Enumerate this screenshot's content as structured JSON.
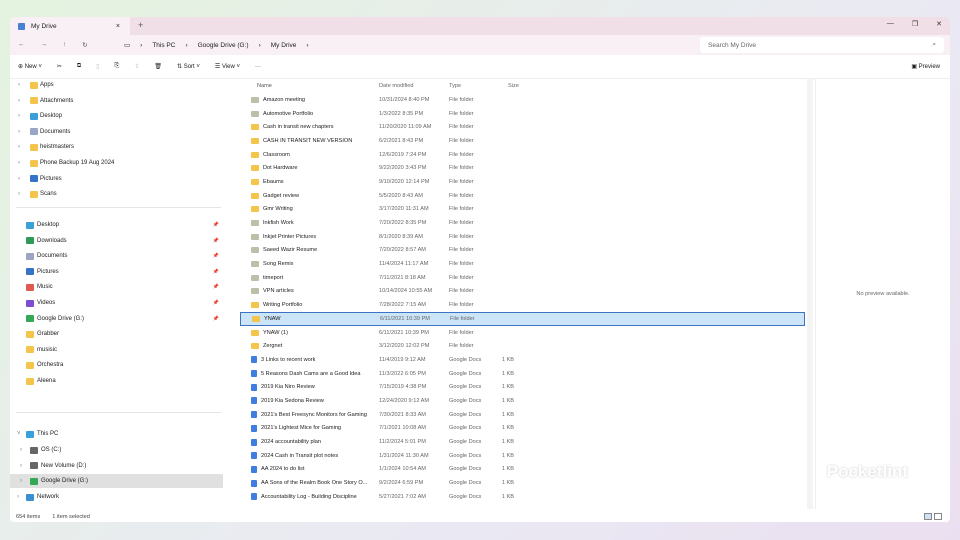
{
  "window": {
    "tab_title": "My Drive",
    "new_tab": "+",
    "close_tab": "×"
  },
  "address": {
    "crumbs": [
      "This PC",
      "Google Drive (G:)",
      "My Drive"
    ],
    "search_placeholder": "Search My Drive"
  },
  "toolbar": {
    "new": "New",
    "sort": "Sort",
    "view": "View",
    "more": "···",
    "preview": "Preview"
  },
  "sidebar": {
    "drive_items": [
      "Apps",
      "Attachments",
      "Desktop",
      "Documents",
      "heistmasters",
      "Phone Backup 19 Aug 2024",
      "Pictures",
      "Scans"
    ],
    "quick_access": [
      {
        "label": "Desktop",
        "pinned": true
      },
      {
        "label": "Downloads",
        "pinned": true
      },
      {
        "label": "Documents",
        "pinned": true
      },
      {
        "label": "Pictures",
        "pinned": true
      },
      {
        "label": "Music",
        "pinned": true
      },
      {
        "label": "Videos",
        "pinned": true
      },
      {
        "label": "Google Drive (G:)",
        "pinned": true
      },
      {
        "label": "Grabber"
      },
      {
        "label": "musisic"
      },
      {
        "label": "Orchestra"
      },
      {
        "label": "Aleena"
      }
    ],
    "this_pc": "This PC",
    "drives": [
      "OS (C:)",
      "New Volume (D:)",
      "Google Drive (G:)"
    ],
    "selected_drive": "Google Drive (G:)",
    "network": "Network"
  },
  "columns": [
    "Name",
    "Date modified",
    "Type",
    "Size"
  ],
  "files": [
    {
      "name": "Amazon meeting",
      "date": "10/31/2024 8:40 PM",
      "type": "File folder",
      "size": "",
      "icon": "shared"
    },
    {
      "name": "Automotive Portfolio",
      "date": "1/3/2022 8:35 PM",
      "type": "File folder",
      "size": "",
      "icon": "shared"
    },
    {
      "name": "Cash in transit new chapters",
      "date": "11/20/2020 11:09 AM",
      "type": "File folder",
      "size": "",
      "icon": "folder"
    },
    {
      "name": "CASH IN TRANSIT NEW VERSION",
      "date": "6/2/2021 8:43 PM",
      "type": "File folder",
      "size": "",
      "icon": "folder"
    },
    {
      "name": "Classroom",
      "date": "12/6/2019 7:24 PM",
      "type": "File folder",
      "size": "",
      "icon": "folder"
    },
    {
      "name": "Dot Hardware",
      "date": "9/22/2020 3:43 PM",
      "type": "File folder",
      "size": "",
      "icon": "folder"
    },
    {
      "name": "Ebaums",
      "date": "9/10/2020 12:14 PM",
      "type": "File folder",
      "size": "",
      "icon": "folder"
    },
    {
      "name": "Gadget review",
      "date": "5/5/2020 8:43 AM",
      "type": "File folder",
      "size": "",
      "icon": "folder"
    },
    {
      "name": "Gmr Writing",
      "date": "3/17/2020 11:31 AM",
      "type": "File folder",
      "size": "",
      "icon": "folder"
    },
    {
      "name": "Inkfish Work",
      "date": "7/20/2022 8:35 PM",
      "type": "File folder",
      "size": "",
      "icon": "shared"
    },
    {
      "name": "Inkjet Printer Pictures",
      "date": "8/1/2020 8:39 AM",
      "type": "File folder",
      "size": "",
      "icon": "shared"
    },
    {
      "name": "Saeed Wazir Resume",
      "date": "7/20/2022 8:57 AM",
      "type": "File folder",
      "size": "",
      "icon": "shared"
    },
    {
      "name": "Song Remix",
      "date": "11/4/2024 11:17 AM",
      "type": "File folder",
      "size": "",
      "icon": "shared"
    },
    {
      "name": "timeport",
      "date": "7/11/2021 8:18 AM",
      "type": "File folder",
      "size": "",
      "icon": "shared"
    },
    {
      "name": "VPN articles",
      "date": "10/14/2024 10:55 AM",
      "type": "File folder",
      "size": "",
      "icon": "shared"
    },
    {
      "name": "Writing Portfolio",
      "date": "7/28/2022 7:15 AM",
      "type": "File folder",
      "size": "",
      "icon": "folder"
    },
    {
      "name": "YNAW",
      "date": "6/11/2021 10:39 PM",
      "type": "File folder",
      "size": "",
      "icon": "folder",
      "selected": true
    },
    {
      "name": "YNAW (1)",
      "date": "6/11/2021 10:39 PM",
      "type": "File folder",
      "size": "",
      "icon": "folder"
    },
    {
      "name": "Zergnet",
      "date": "3/12/2020 12:02 PM",
      "type": "File folder",
      "size": "",
      "icon": "folder"
    },
    {
      "name": "3 Links to recent work",
      "date": "11/4/2019 9:12 AM",
      "type": "Google Docs",
      "size": "1 KB",
      "icon": "doc"
    },
    {
      "name": "5 Reasons Dash Cams are a Good Idea",
      "date": "11/3/2022 6:05 PM",
      "type": "Google Docs",
      "size": "1 KB",
      "icon": "doc"
    },
    {
      "name": "2019 Kia Niro Review",
      "date": "7/15/2019 4:38 PM",
      "type": "Google Docs",
      "size": "1 KB",
      "icon": "doc"
    },
    {
      "name": "2019 Kia Sedona Review",
      "date": "12/24/2020 9:12 AM",
      "type": "Google Docs",
      "size": "1 KB",
      "icon": "doc"
    },
    {
      "name": "2021's Best Freesync Monitors for Gaming",
      "date": "7/30/2021 8:33 AM",
      "type": "Google Docs",
      "size": "1 KB",
      "icon": "doc"
    },
    {
      "name": "2021's Lightest Mice for Gaming",
      "date": "7/1/2021 10:08 AM",
      "type": "Google Docs",
      "size": "1 KB",
      "icon": "doc"
    },
    {
      "name": "2024 accountability plan",
      "date": "11/2/2024 5:01 PM",
      "type": "Google Docs",
      "size": "1 KB",
      "icon": "doc"
    },
    {
      "name": "2024 Cash in Transit plot notes",
      "date": "1/31/2024 11:30 AM",
      "type": "Google Docs",
      "size": "1 KB",
      "icon": "doc"
    },
    {
      "name": "AA 2024 to do list",
      "date": "1/1/2024 10:54 AM",
      "type": "Google Docs",
      "size": "1 KB",
      "icon": "doc"
    },
    {
      "name": "AA Sons of the Realm Book One Story O...",
      "date": "9/2/2024 6:59 PM",
      "type": "Google Docs",
      "size": "1 KB",
      "icon": "doc"
    },
    {
      "name": "Accountability Log - Building Discipline",
      "date": "5/27/2021 7:02 AM",
      "type": "Google Docs",
      "size": "1 KB",
      "icon": "doc"
    }
  ],
  "preview": {
    "message": "No preview available."
  },
  "status": {
    "items": "654 items",
    "selected": "1 item selected"
  },
  "watermark": "Pocketlint"
}
